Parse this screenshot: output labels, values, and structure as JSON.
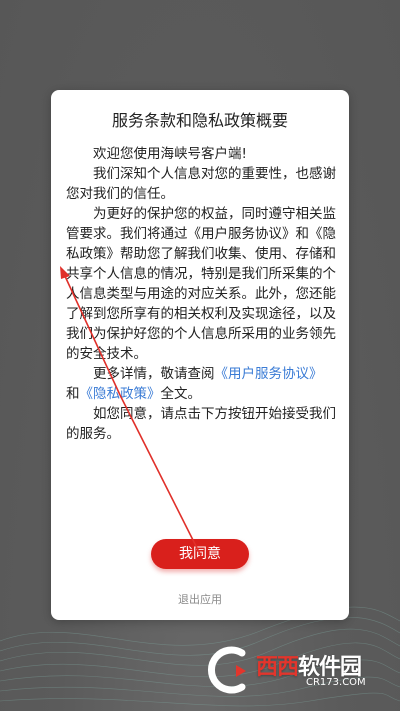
{
  "dialog": {
    "title": "服务条款和隐私政策概要",
    "p1": "欢迎您使用海峡号客户端!",
    "p2": "我们深知个人信息对您的重要性，也感谢您对我们的信任。",
    "p3_a": "为更好的保护您的权益，同时遵守相关监管要求。我们将通过《用户服务协议》和《隐私政策》帮助您了解我们收集、使用、存储和共享个人信息的情况，特别是我们所采集的个人信息类型与用途的对应关系。此外，您还能了解到您所享有的相关权利及实现途径，以及我们为保护好您的个人信息所采用的业务领先的安全技术。",
    "p4_a": "更多详情，敬请查阅",
    "p4_link1": "《用户服务协议》",
    "p4_b": "和",
    "p4_link2": "《隐私政策》",
    "p4_c": "全文。",
    "p5": "如您同意，请点击下方按钮开始接受我们的服务。",
    "agree_label": "我同意",
    "exit_label": "退出应用"
  },
  "watermark": {
    "brand_part1": "西西",
    "brand_part2": "软件园",
    "url": "CR173.COM"
  },
  "colors": {
    "accent_red": "#d9201c",
    "link_blue": "#3a7bd5",
    "backdrop": "#5e5e5e"
  }
}
